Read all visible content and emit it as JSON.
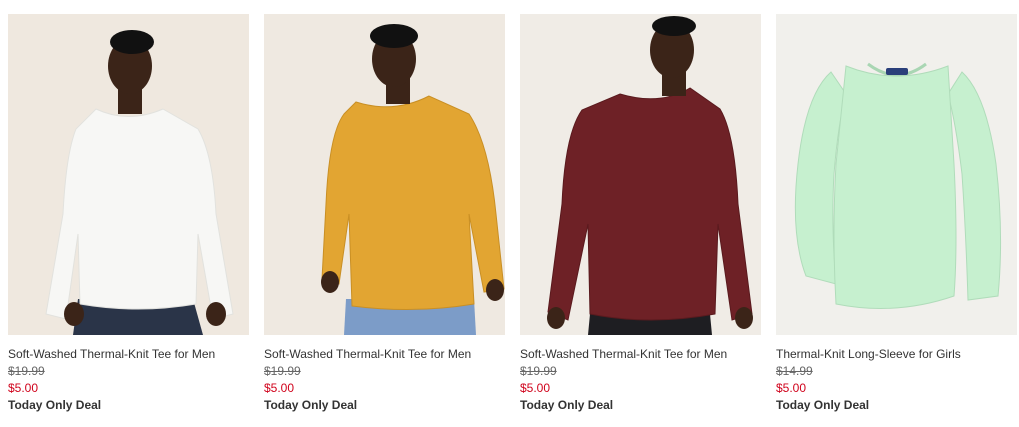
{
  "products": [
    {
      "name": "Soft-Washed Thermal-Knit Tee for Men",
      "original_price": "$19.99",
      "sale_price": "$5.00",
      "deal": "Today Only Deal",
      "shirt_color": "#f7f7f5"
    },
    {
      "name": "Soft-Washed Thermal-Knit Tee for Men",
      "original_price": "$19.99",
      "sale_price": "$5.00",
      "deal": "Today Only Deal",
      "shirt_color": "#e2a532"
    },
    {
      "name": "Soft-Washed Thermal-Knit Tee for Men",
      "original_price": "$19.99",
      "sale_price": "$5.00",
      "deal": "Today Only Deal",
      "shirt_color": "#6e2126"
    },
    {
      "name": "Thermal-Knit Long-Sleeve for Girls",
      "original_price": "$14.99",
      "sale_price": "$5.00",
      "deal": "Today Only Deal",
      "shirt_color": "#c6f0cf"
    }
  ]
}
